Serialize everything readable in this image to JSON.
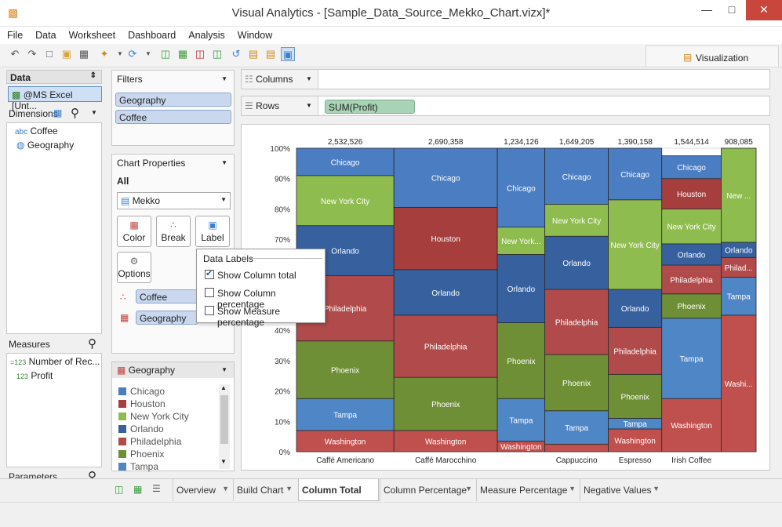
{
  "window": {
    "title": "Visual Analytics - [Sample_Data_Source_Mekko_Chart.vizx]*",
    "min": "—",
    "max": "□",
    "close": "✕"
  },
  "menu": [
    "File",
    "Data",
    "Worksheet",
    "Dashboard",
    "Analysis",
    "Window"
  ],
  "toolbar": {
    "visualization_tab": "Visualization"
  },
  "data_panel": {
    "title": "Data",
    "source": "@MS Excel [Unt..."
  },
  "dimensions": {
    "title": "Dimensions",
    "items": [
      {
        "prefix": "abc",
        "label": "Coffee"
      },
      {
        "prefix": "◍",
        "label": "Geography"
      }
    ]
  },
  "measures": {
    "title": "Measures",
    "items": [
      {
        "prefix": "=123",
        "label": "Number of Rec..."
      },
      {
        "prefix": "123",
        "label": "Profit"
      }
    ]
  },
  "parameters": {
    "title": "Parameters"
  },
  "filters": {
    "title": "Filters",
    "items": [
      "Geography",
      "Coffee"
    ]
  },
  "chart_properties": {
    "title": "Chart Properties",
    "scope": "All",
    "chart_type": "Mekko",
    "buttons": [
      "Color",
      "Break",
      "Label",
      "Options"
    ],
    "fields": [
      "Coffee",
      "Geography"
    ]
  },
  "legend": {
    "title": "Geography",
    "items": [
      {
        "label": "Chicago",
        "color": "#4a7dc2"
      },
      {
        "label": "Houston",
        "color": "#a63e3e"
      },
      {
        "label": "New York City",
        "color": "#8fbc4f"
      },
      {
        "label": "Orlando",
        "color": "#37609f"
      },
      {
        "label": "Philadelphia",
        "color": "#b14a4a"
      },
      {
        "label": "Phoenix",
        "color": "#6f8f36"
      },
      {
        "label": "Tampa",
        "color": "#4f86c6"
      }
    ]
  },
  "data_labels_popup": {
    "title": "Data Labels",
    "options": [
      {
        "label": "Show Column total",
        "checked": true
      },
      {
        "label": "Show Column percentage",
        "checked": false
      },
      {
        "label": "Show Measure percentage",
        "checked": false
      }
    ]
  },
  "shelves": {
    "columns_label": "Columns",
    "rows_label": "Rows",
    "rows_pill": "SUM(Profit)"
  },
  "bottom_tabs": [
    {
      "label": "Overview",
      "active": false
    },
    {
      "label": "Build Chart",
      "active": false
    },
    {
      "label": "Column Total",
      "active": true
    },
    {
      "label": "Column Percentage",
      "active": false
    },
    {
      "label": "Measure Percentage",
      "active": false
    },
    {
      "label": "Negative Values",
      "active": false
    }
  ],
  "chart_data": {
    "type": "bar",
    "subtype": "mekko",
    "y_ticks": [
      "0%",
      "10%",
      "20%",
      "30%",
      "40%",
      "50%",
      "60%",
      "70%",
      "80%",
      "90%",
      "100%"
    ],
    "columns": [
      {
        "category": "Caffé Americano",
        "total": "2,532,526",
        "totalValue": 2532526,
        "segments": [
          [
            "Washington",
            7
          ],
          [
            "Tampa",
            10.5
          ],
          [
            "Phoenix",
            19
          ],
          [
            "Philadelphia",
            21.5
          ],
          [
            "Orlando",
            16.5
          ],
          [
            "New York City",
            16.5
          ],
          [
            "Chicago",
            9
          ]
        ]
      },
      {
        "category": "Caffé Marocchino",
        "total": "2,690,358",
        "totalValue": 2690358,
        "segments": [
          [
            "Washington",
            7
          ],
          [
            "Phoenix",
            17.5
          ],
          [
            "Philadelphia",
            20.5
          ],
          [
            "Orlando",
            15
          ],
          [
            "Houston",
            20.5
          ],
          [
            "Chicago",
            19.5
          ]
        ]
      },
      {
        "category": "",
        "total": "1,234,126",
        "totalValue": 1234126,
        "segments": [
          [
            "Washington",
            3.5
          ],
          [
            "Tampa",
            14
          ],
          [
            "Phoenix",
            25
          ],
          [
            "Orlando",
            22.5
          ],
          [
            "New York...",
            9
          ],
          [
            "Chicago",
            26
          ]
        ]
      },
      {
        "category": "Cappuccino",
        "total": "1,649,205",
        "totalValue": 1649205,
        "segments": [
          [
            "Washington",
            2.5
          ],
          [
            "Tampa",
            11
          ],
          [
            "Phoenix",
            18.5
          ],
          [
            "Philadelphia",
            21.5
          ],
          [
            "Orlando",
            17.5
          ],
          [
            "New York City",
            10.5
          ],
          [
            "Chicago",
            18.5
          ]
        ]
      },
      {
        "category": "Espresso",
        "total": "1,390,158",
        "totalValue": 1390158,
        "segments": [
          [
            "Washington",
            7.5
          ],
          [
            "Tampa",
            3.5
          ],
          [
            "Phoenix",
            14.5
          ],
          [
            "Philadelphia",
            15.5
          ],
          [
            "Orlando",
            12.5
          ],
          [
            "New York City",
            29.5
          ],
          [
            "Chicago",
            17
          ]
        ]
      },
      {
        "category": "Irish Coffee",
        "total": "1,544,514",
        "totalValue": 1544514,
        "segments": [
          [
            "Washington",
            17.5
          ],
          [
            "Tampa",
            26.5
          ],
          [
            "Phoenix",
            8
          ],
          [
            "Philadelphia",
            9.5
          ],
          [
            "Orlando",
            7
          ],
          [
            "New York City",
            11.5
          ],
          [
            "Houston",
            10
          ],
          [
            "Chicago",
            7.5
          ]
        ]
      },
      {
        "category": "",
        "total": "908,085",
        "totalValue": 908085,
        "segments": [
          [
            "Washi...",
            45
          ],
          [
            "Tampa",
            12.5
          ],
          [
            "Philad...",
            6.5
          ],
          [
            "Orlando",
            5
          ],
          [
            "New ...",
            31
          ]
        ]
      }
    ]
  }
}
